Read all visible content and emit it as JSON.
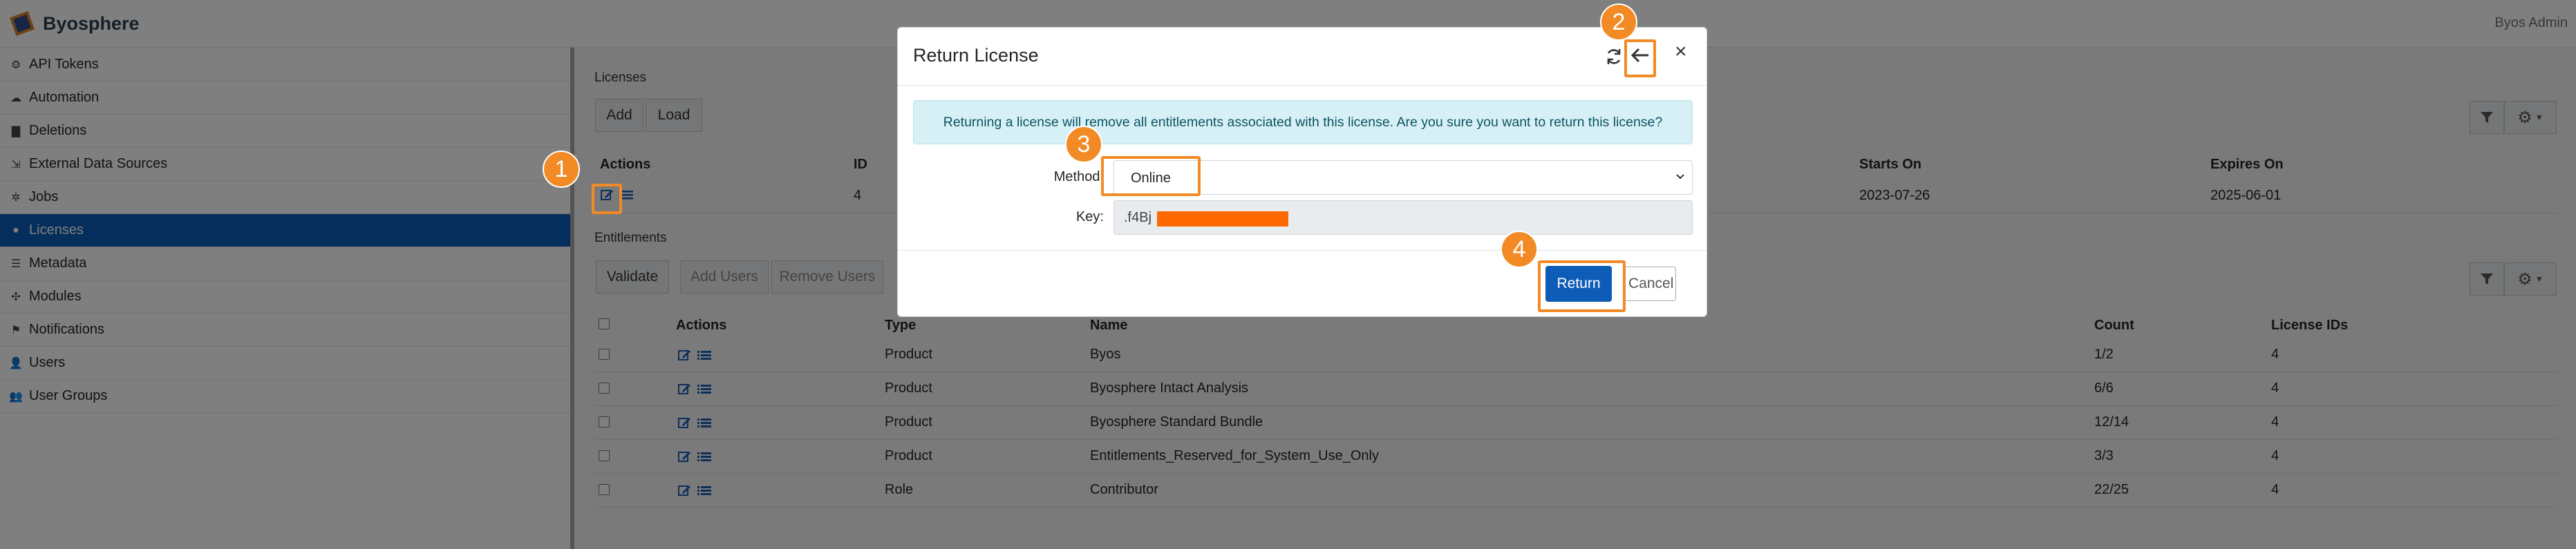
{
  "app": {
    "name": "Byosphere",
    "user": "Byos Admin"
  },
  "sidebar": {
    "items": [
      {
        "label": "API Tokens",
        "icon": "gear-icon"
      },
      {
        "label": "Automation",
        "icon": "cloud-gear-icon"
      },
      {
        "label": "Deletions",
        "icon": "trash-icon"
      },
      {
        "label": "External Data Sources",
        "icon": "external-icon"
      },
      {
        "label": "Jobs",
        "icon": "run-icon"
      },
      {
        "label": "Licenses",
        "icon": "circle-icon",
        "active": true
      },
      {
        "label": "Metadata",
        "icon": "database-icon"
      },
      {
        "label": "Modules",
        "icon": "puzzle-icon"
      },
      {
        "label": "Notifications",
        "icon": "flag-icon"
      },
      {
        "label": "Users",
        "icon": "user-icon"
      },
      {
        "label": "User Groups",
        "icon": "users-icon"
      }
    ]
  },
  "licenses": {
    "title": "Licenses",
    "add_label": "Add",
    "load_label": "Load",
    "columns": [
      "Actions",
      "ID",
      "Starts On",
      "Expires On"
    ],
    "rows": [
      {
        "id": "4",
        "starts_on": "2023-07-26",
        "expires_on": "2025-06-01"
      }
    ]
  },
  "entitlements": {
    "title": "Entitlements",
    "validate_label": "Validate",
    "add_users_label": "Add Users",
    "remove_users_label": "Remove Users",
    "columns": [
      "Actions",
      "Type",
      "Name",
      "Count",
      "License IDs"
    ],
    "rows": [
      {
        "type": "Product",
        "name": "Byos",
        "count": "1/2",
        "license_ids": "4"
      },
      {
        "type": "Product",
        "name": "Byosphere Intact Analysis",
        "count": "6/6",
        "license_ids": "4"
      },
      {
        "type": "Product",
        "name": "Byosphere Standard Bundle",
        "count": "12/14",
        "license_ids": "4"
      },
      {
        "type": "Product",
        "name": "Entitlements_Reserved_for_System_Use_Only",
        "count": "3/3",
        "license_ids": "4"
      },
      {
        "type": "Role",
        "name": "Contributor",
        "count": "22/25",
        "license_ids": "4"
      }
    ]
  },
  "modal": {
    "title": "Return License",
    "message": "Returning a license will remove all entitlements associated with this license. Are you sure you want to return this license?",
    "method_label": "Method:",
    "method_value": "Online",
    "key_label": "Key:",
    "key_value": ".f4Bj",
    "return_label": "Return",
    "cancel_label": "Cancel",
    "close_glyph": "×"
  },
  "callouts": [
    "1",
    "2",
    "3",
    "4"
  ],
  "colors": {
    "accent": "#0d5db8",
    "callout": "#f28a25",
    "alert_bg": "#d7f0f5",
    "redaction": "#ff6a00"
  }
}
